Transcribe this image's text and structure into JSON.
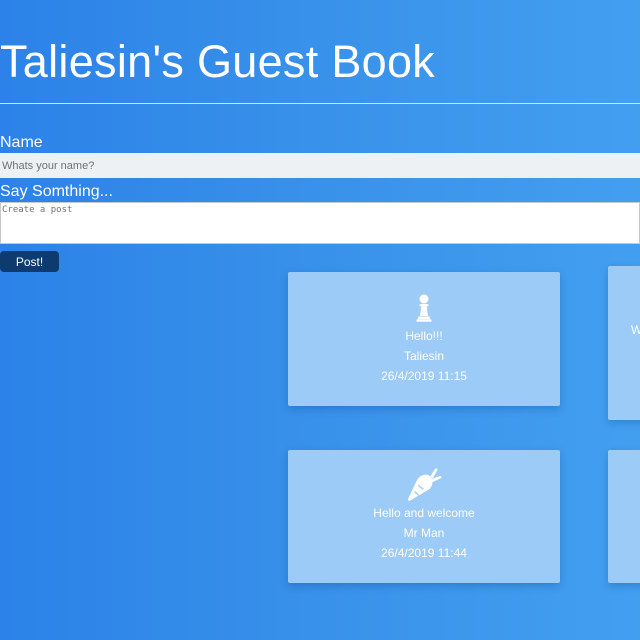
{
  "page": {
    "title": "Taliesin's Guest Book"
  },
  "form": {
    "name_label": "Name",
    "name_placeholder": "Whats your name?",
    "post_label": "Say Somthing...",
    "post_placeholder": "Create a post",
    "submit_label": "Post!"
  },
  "posts": [
    {
      "icon": "chess-pawn-icon",
      "message": "Hello!!!",
      "author": "Taliesin",
      "date": "26/4/2019 11:15"
    },
    {
      "partial_text": "W"
    },
    {
      "icon": "carrot-icon",
      "message": "Hello and welcome",
      "author": "Mr Man",
      "date": "26/4/2019 11:44"
    },
    {}
  ],
  "colors": {
    "background_start": "#2c82e8",
    "background_end": "#429ff0",
    "card": "#9ccbf7",
    "button": "#0d3b70",
    "text": "#ffffff"
  }
}
